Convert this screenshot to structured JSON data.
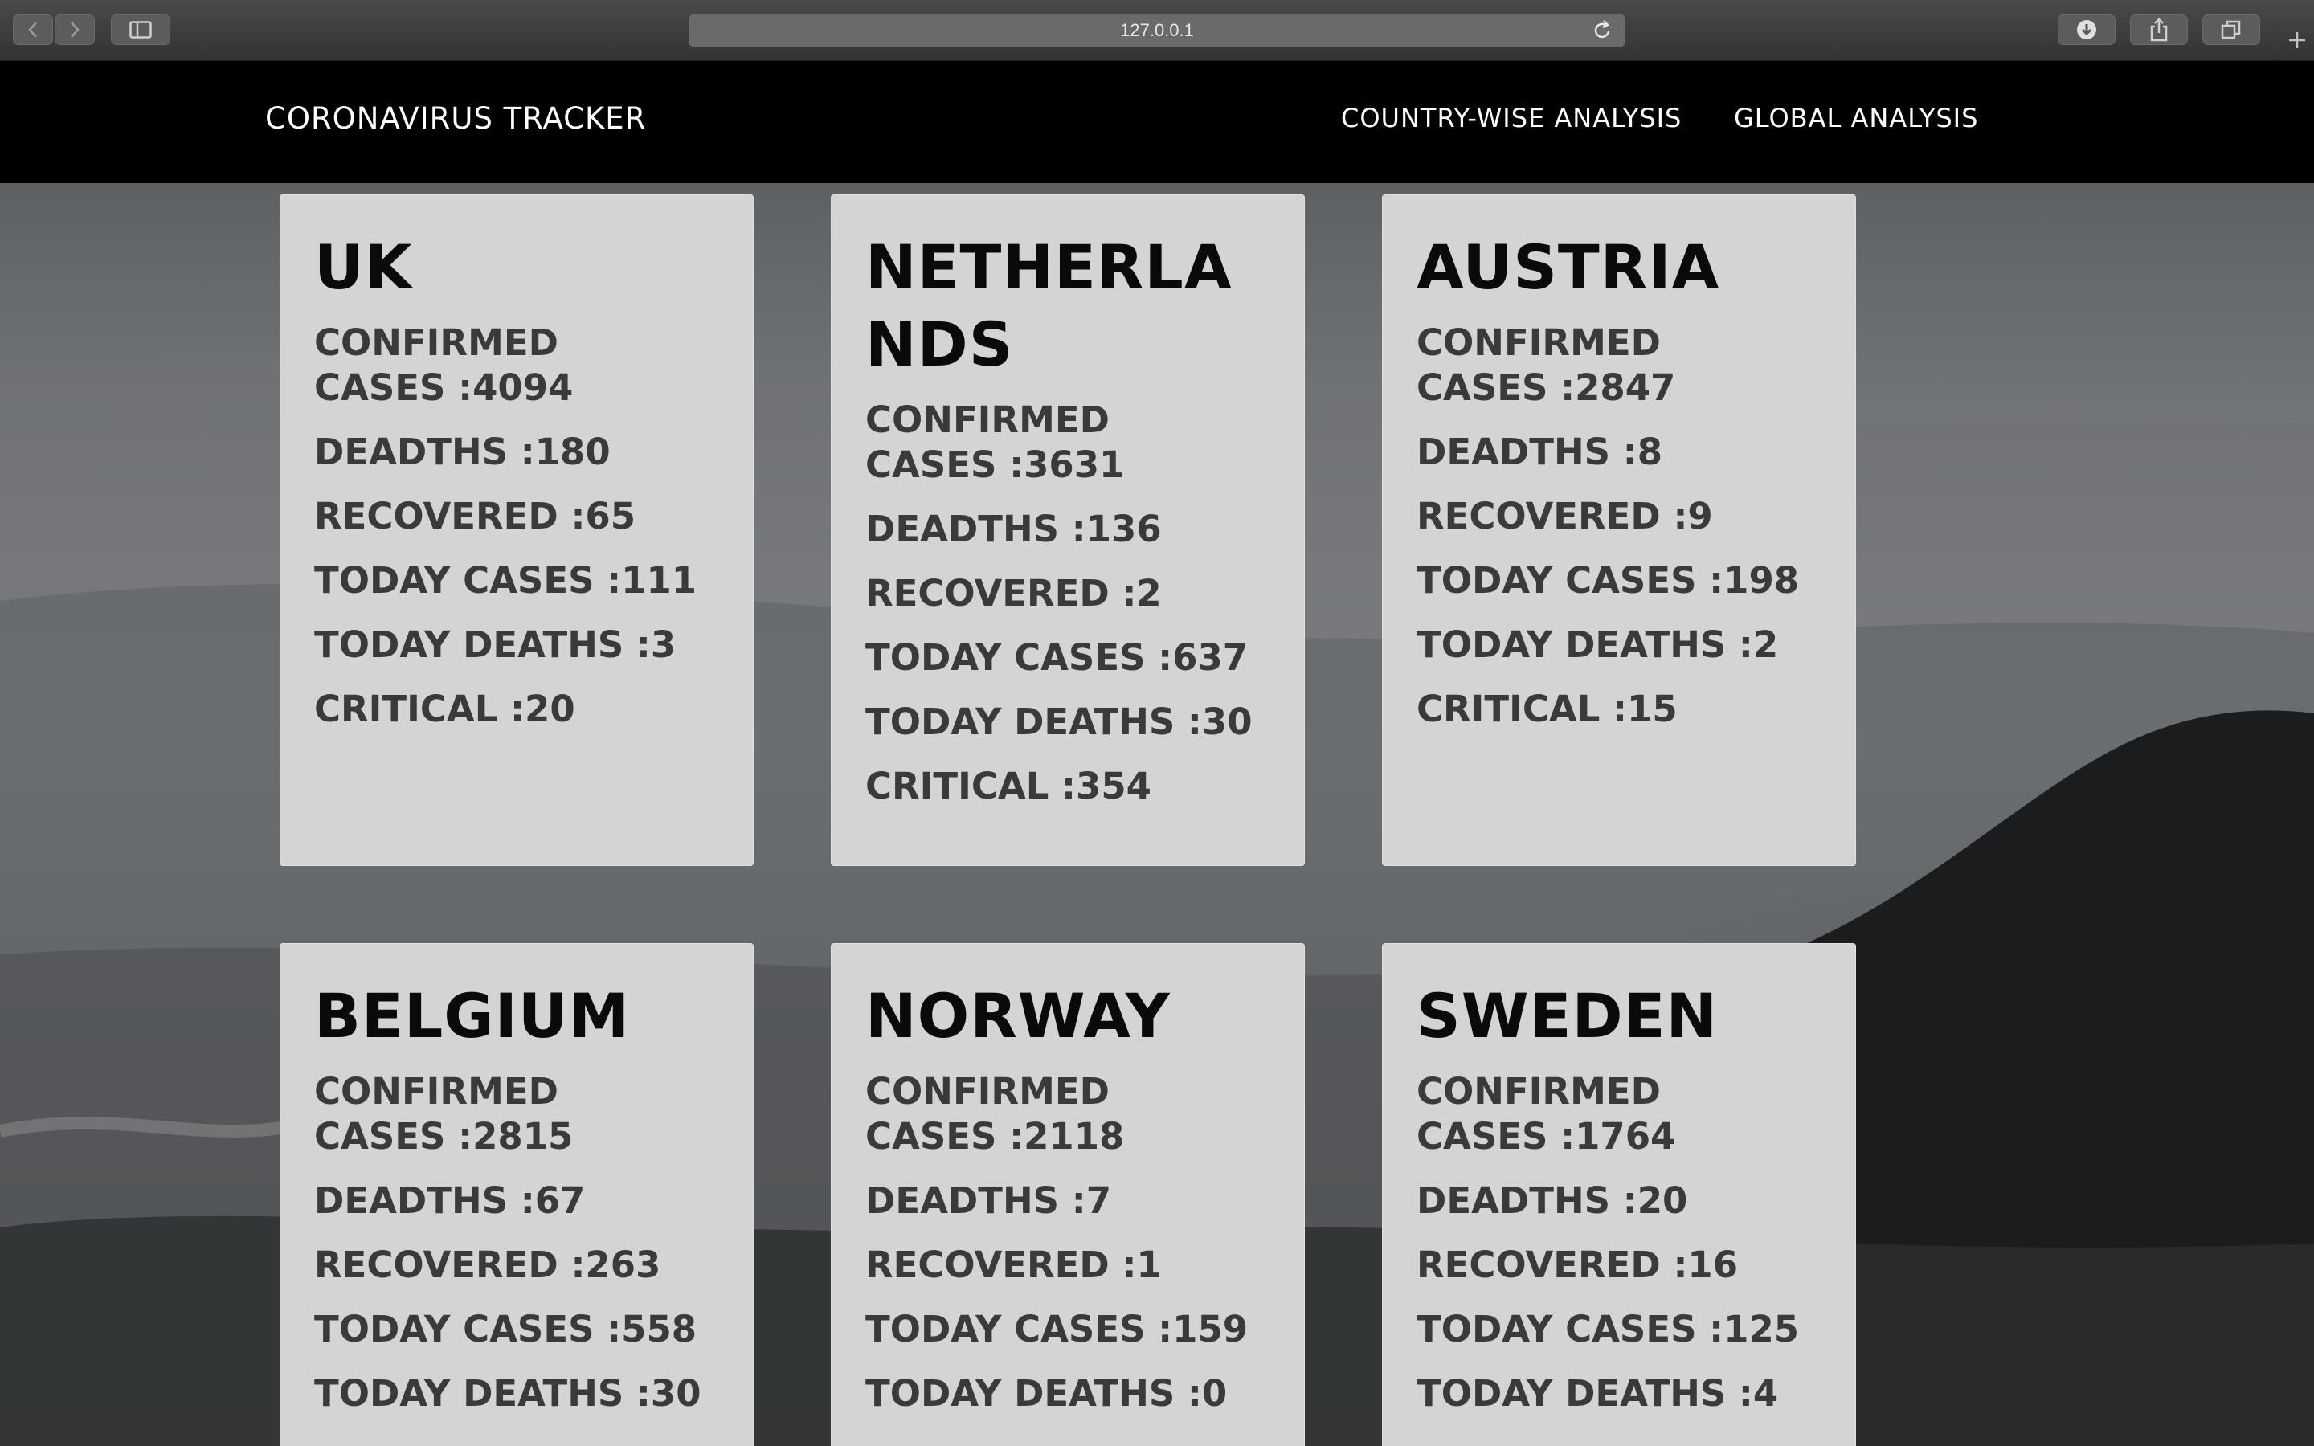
{
  "browser": {
    "url": "127.0.0.1",
    "icons": [
      "back-icon",
      "forward-icon",
      "sidebar-icon",
      "reload-icon",
      "download-icon",
      "share-icon",
      "tabs-icon",
      "new-tab-icon"
    ]
  },
  "site": {
    "brand": "CORONAVIRUS TRACKER",
    "nav": [
      "COUNTRY-WISE ANALYSIS",
      "GLOBAL ANALYSIS"
    ]
  },
  "labels": {
    "confirmed": "CONFIRMED CASES",
    "deaths": "DEADTHS :",
    "recovered": "RECOVERED :",
    "today_cases": "TODAY CASES :",
    "today_deaths": "TODAY DEATHS :",
    "critical": "CRITICAL :"
  },
  "countries": [
    {
      "name": "UK",
      "confirmed": ":4094",
      "deaths": "DEADTHS :180",
      "recovered": "RECOVERED :65",
      "today_cases": "TODAY CASES :111",
      "today_deaths": "TODAY DEATHS :3",
      "critical": "CRITICAL :20"
    },
    {
      "name": "NETHERLANDS",
      "confirmed": ":3631",
      "deaths": "DEADTHS :136",
      "recovered": "RECOVERED :2",
      "today_cases": "TODAY CASES :637",
      "today_deaths": "TODAY DEATHS :30",
      "critical": "CRITICAL :354"
    },
    {
      "name": "AUSTRIA",
      "confirmed": ":2847",
      "deaths": "DEADTHS :8",
      "recovered": "RECOVERED :9",
      "today_cases": "TODAY CASES :198",
      "today_deaths": "TODAY DEATHS :2",
      "critical": "CRITICAL :15"
    },
    {
      "name": "BELGIUM",
      "confirmed": ":2815",
      "deaths": "DEADTHS :67",
      "recovered": "RECOVERED :263",
      "today_cases": "TODAY CASES :558",
      "today_deaths": "TODAY DEATHS :30"
    },
    {
      "name": "NORWAY",
      "confirmed": ":2118",
      "deaths": "DEADTHS :7",
      "recovered": "RECOVERED :1",
      "today_cases": "TODAY CASES :159",
      "today_deaths": "TODAY DEATHS :0"
    },
    {
      "name": "SWEDEN",
      "confirmed": ":1764",
      "deaths": "DEADTHS :20",
      "recovered": "RECOVERED :16",
      "today_cases": "TODAY CASES :125",
      "today_deaths": "TODAY DEATHS :4"
    }
  ]
}
